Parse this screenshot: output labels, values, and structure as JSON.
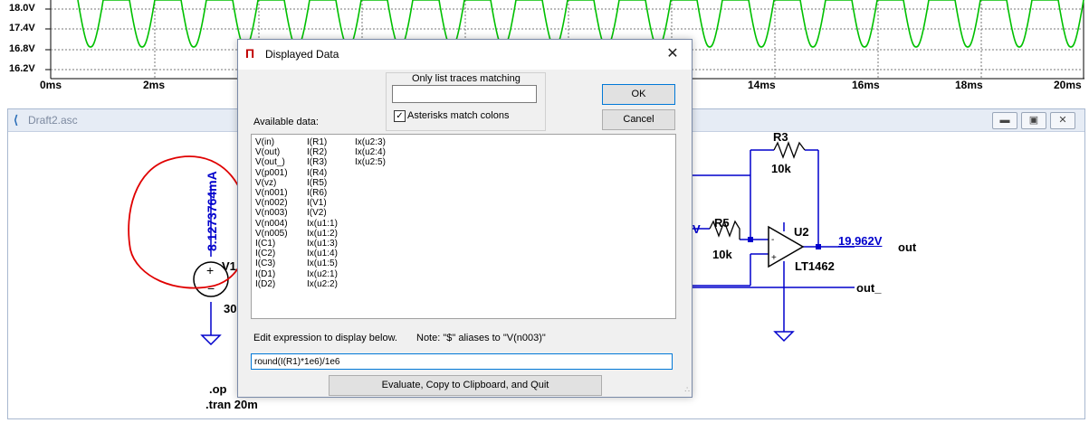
{
  "waveform": {
    "y_ticks": [
      "18.0V",
      "17.4V",
      "16.8V",
      "16.2V"
    ],
    "x_ticks": [
      "0ms",
      "2ms",
      "14ms",
      "16ms",
      "18ms",
      "20ms"
    ],
    "trace_color": "#00c000"
  },
  "schematic": {
    "window_title": "Draft2.asc",
    "window_buttons": [
      "minimize",
      "restore",
      "close"
    ],
    "annotation_current": "8.1273764mA",
    "annotation_circle_color": "#e00000",
    "wire_color": "#0000cc",
    "labels": {
      "v1": "V1",
      "v1_value": "30",
      "r3": "R3",
      "r3_value": "10k",
      "r5": "R5",
      "r5_value": "10k",
      "u2": "U2",
      "u2_part": "LT1462",
      "vout_value": "19.962V",
      "net_out": "out",
      "net_out_": "out_",
      "partial_v": "V",
      "directive_op": ".op",
      "directive_tran": ".tran 20m"
    }
  },
  "dialog": {
    "title": "Displayed Data",
    "close_glyph": "✕",
    "filter_label": "Only list traces matching",
    "filter_value": "",
    "asterisk_label": "Asterisks match colons",
    "asterisk_checked": true,
    "ok_label": "OK",
    "cancel_label": "Cancel",
    "available_label": "Available data:",
    "col1": [
      "V(in)",
      "V(out)",
      "V(out_)",
      "V(p001)",
      "V(vz)",
      "V(n001)",
      "V(n002)",
      "V(n003)",
      "V(n004)",
      "V(n005)",
      "I(C1)",
      "I(C2)",
      "I(C3)",
      "I(D1)",
      "I(D2)"
    ],
    "col2": [
      "I(R1)",
      "I(R2)",
      "I(R3)",
      "I(R4)",
      "I(R5)",
      "I(R6)",
      "I(V1)",
      "I(V2)",
      "Ix(u1:1)",
      "Ix(u1:2)",
      "Ix(u1:3)",
      "Ix(u1:4)",
      "Ix(u1:5)",
      "Ix(u2:1)",
      "Ix(u2:2)"
    ],
    "col3": [
      "Ix(u2:3)",
      "Ix(u2:4)",
      "Ix(u2:5)"
    ],
    "expression_label": "Edit expression to display below.",
    "note_label": "Note: \"$\" aliases to \"V(n003)\"",
    "expression_value": "round(I(R1)*1e6)/1e6",
    "evaluate_label": "Evaluate, Copy to Clipboard, and Quit"
  }
}
